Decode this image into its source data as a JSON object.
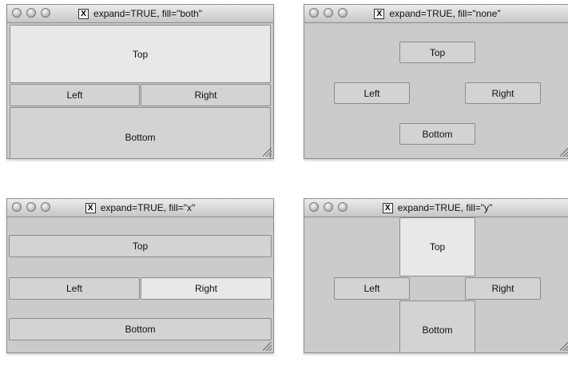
{
  "windows": [
    {
      "title": "expand=TRUE, fill=\"both\"",
      "buttons": {
        "top": "Top",
        "left": "Left",
        "right": "Right",
        "bottom": "Bottom"
      }
    },
    {
      "title": "expand=TRUE, fill=\"none\"",
      "buttons": {
        "top": "Top",
        "left": "Left",
        "right": "Right",
        "bottom": "Bottom"
      }
    },
    {
      "title": "expand=TRUE, fill=\"x\"",
      "buttons": {
        "top": "Top",
        "left": "Left",
        "right": "Right",
        "bottom": "Bottom"
      }
    },
    {
      "title": "expand=TRUE, fill=\"y\"",
      "buttons": {
        "top": "Top",
        "left": "Left",
        "right": "Right",
        "bottom": "Bottom"
      }
    }
  ],
  "icons": {
    "app": "x11-icon",
    "window_controls": [
      "close-icon",
      "minimize-icon",
      "zoom-icon"
    ],
    "resize": "resize-grip-icon"
  }
}
